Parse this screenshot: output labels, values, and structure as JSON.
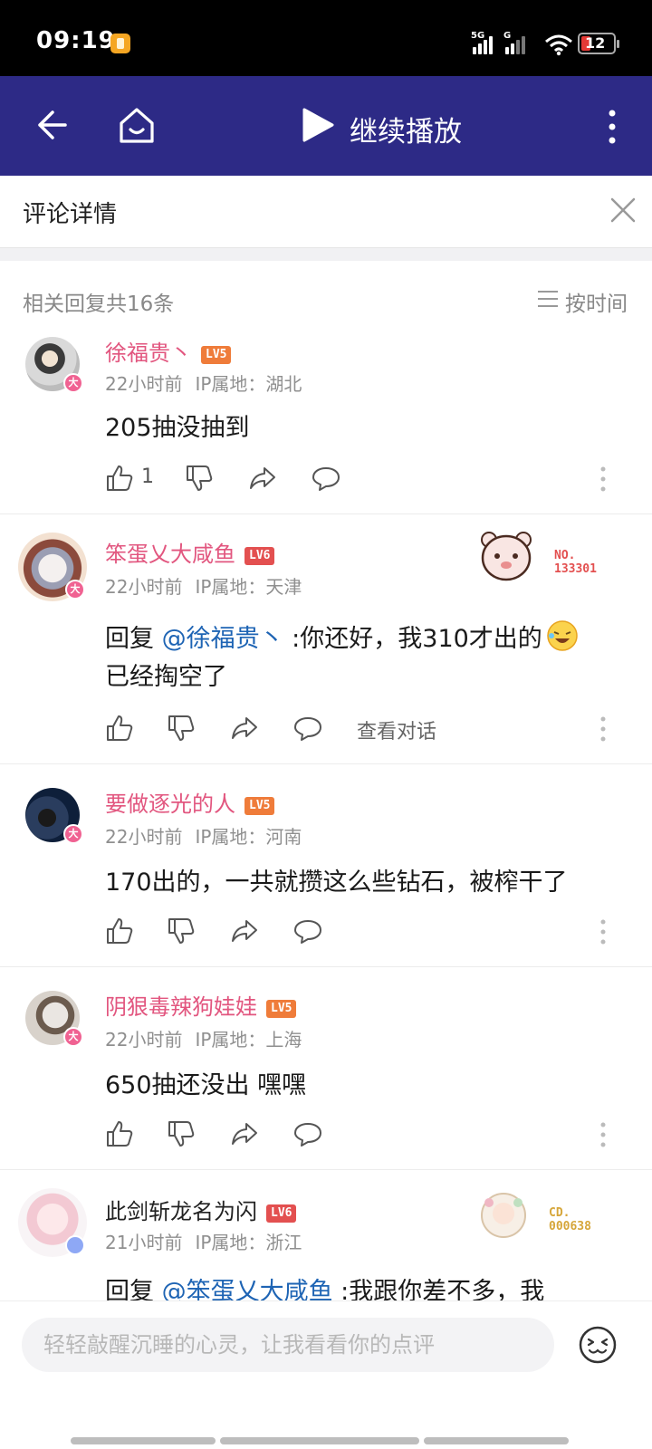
{
  "status_bar": {
    "time": "09:19",
    "network_1": "5G",
    "network_2": "G",
    "battery": "12"
  },
  "top_bar": {
    "play_label": "继续播放"
  },
  "detail_header": {
    "title": "评论详情"
  },
  "replies": {
    "count_label": "相关回复共16条",
    "sort_label": "按时间"
  },
  "comments": [
    {
      "name": "徐福贵丶",
      "level": "LV5",
      "time": "22小时前",
      "ip": "IP属地：湖北",
      "text": "205抽没抽到",
      "like_count": "1",
      "view_conversation": "",
      "badge": "大"
    },
    {
      "name": "笨蛋乂大咸鱼",
      "level": "LV6",
      "time": "22小时前",
      "ip": "IP属地：天津",
      "reply_prefix": "回复 ",
      "mention": "@徐福贵丶",
      "text": " :你还好，我310才出的",
      "text_line2": "已经掏空了",
      "view_conversation": "查看对话",
      "decor_no": "NO.",
      "decor_num": "133301",
      "badge": "大"
    },
    {
      "name": "要做逐光的人",
      "level": "LV5",
      "time": "22小时前",
      "ip": "IP属地：河南",
      "text": "170出的，一共就攒这么些钻石，被榨干了",
      "badge": "大"
    },
    {
      "name": "阴狠毒辣狗娃娃",
      "level": "LV5",
      "time": "22小时前",
      "ip": "IP属地：上海",
      "text": "650抽还没出 嘿嘿",
      "badge": "大"
    },
    {
      "name": "此剑斩龙名为闪",
      "level": "LV6",
      "time": "21小时前",
      "ip": "IP属地：浙江",
      "reply_prefix": "回复 ",
      "mention": "@笨蛋乂大咸鱼",
      "text": " :我跟你差不多，我",
      "decor_no": "CD.",
      "decor_num": "000638"
    }
  ],
  "bottom_bar": {
    "placeholder": "轻轻敲醒沉睡的心灵，让我看看你的点评"
  },
  "colors": {
    "header_bg": "#2d2a86",
    "username": "#e2567f",
    "mention": "#1e64b4",
    "level_orange": "#ef7c3a",
    "level_red": "#e35050"
  }
}
